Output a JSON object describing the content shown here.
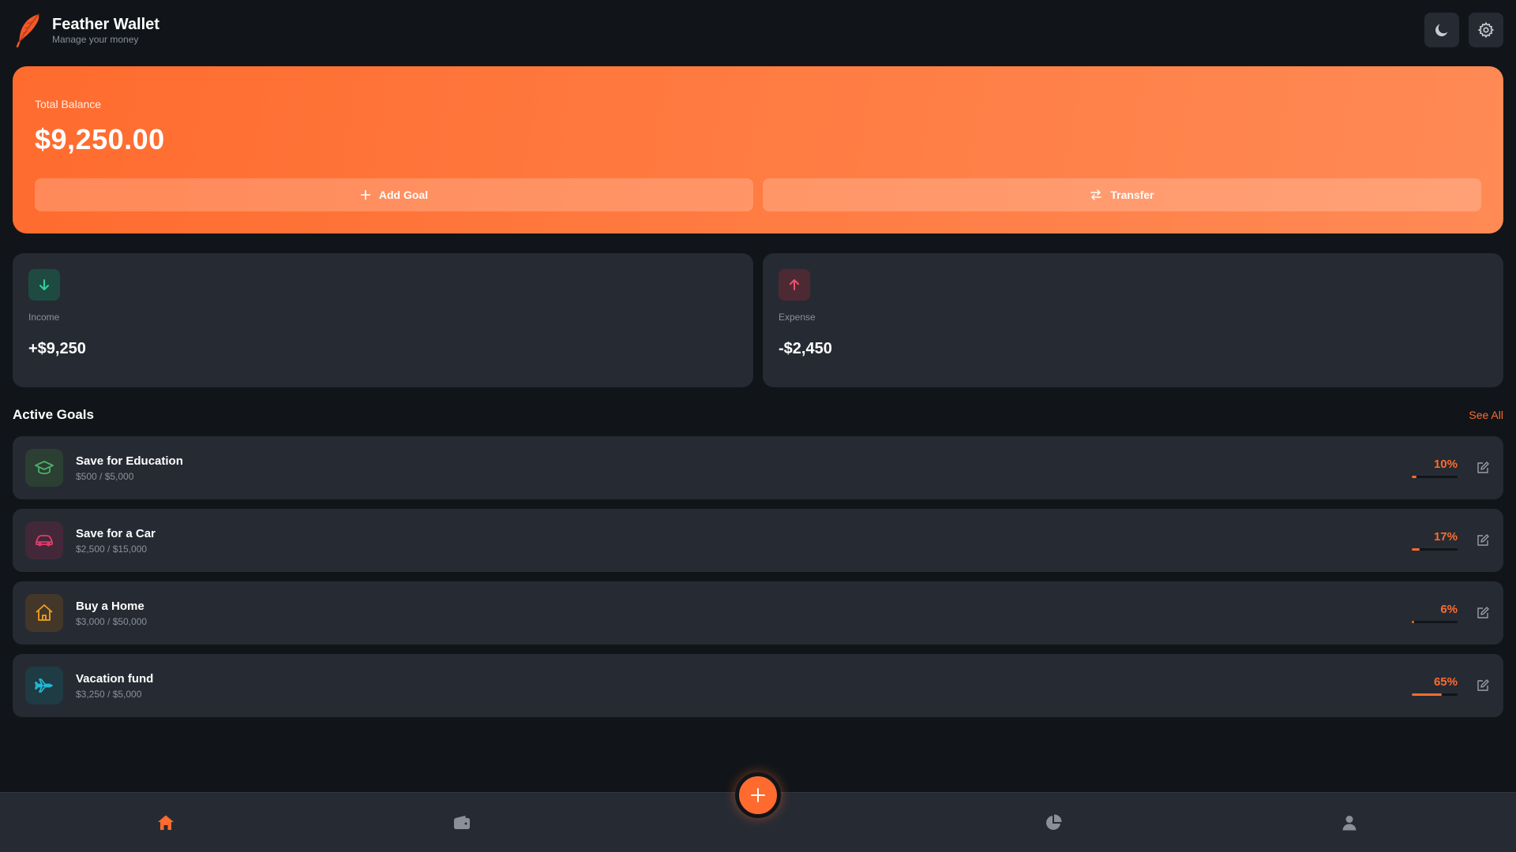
{
  "app": {
    "title": "Feather Wallet",
    "subtitle": "Manage your money",
    "accent": "#ff6b2e"
  },
  "header": {
    "actions": [
      {
        "icon": "moon-icon"
      },
      {
        "icon": "gear-icon"
      }
    ]
  },
  "balance": {
    "label": "Total Balance",
    "value": "$9,250.00",
    "add_goal_label": "Add Goal",
    "transfer_label": "Transfer"
  },
  "stats": {
    "income": {
      "label": "Income",
      "value": "+$9,250",
      "color": "#2dd4a0"
    },
    "expense": {
      "label": "Expense",
      "value": "-$2,450",
      "color": "#f0506e"
    }
  },
  "goals_section": {
    "title": "Active Goals",
    "see_all": "See All"
  },
  "goals": [
    {
      "name": "Save for Education",
      "amount": "$500 / $5,000",
      "percent_label": "10%",
      "progress": 0.1,
      "icon": "graduation-cap-icon",
      "color": "#4caf6a",
      "bg": "#2b3f33"
    },
    {
      "name": "Save for a Car",
      "amount": "$2,500 / $15,000",
      "percent_label": "17%",
      "progress": 0.17,
      "icon": "car-icon",
      "color": "#e23b6a",
      "bg": "#43283a"
    },
    {
      "name": "Buy a Home",
      "amount": "$3,000 / $50,000",
      "percent_label": "6%",
      "progress": 0.06,
      "icon": "home-icon",
      "color": "#f0a020",
      "bg": "#43372a"
    },
    {
      "name": "Vacation fund",
      "amount": "$3,250 / $5,000",
      "percent_label": "65%",
      "progress": 0.65,
      "icon": "airplane-icon",
      "color": "#22b8d4",
      "bg": "#1f3b44"
    }
  ],
  "nav": {
    "items": [
      {
        "icon": "home-icon",
        "active": true
      },
      {
        "icon": "wallet-icon",
        "active": false
      },
      {
        "icon": "pie-chart-icon",
        "active": false
      },
      {
        "icon": "user-icon",
        "active": false
      }
    ],
    "fab_icon": "plus-icon"
  }
}
